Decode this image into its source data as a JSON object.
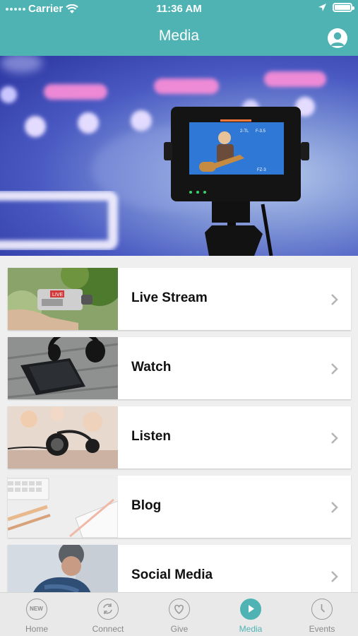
{
  "status_bar": {
    "carrier": "Carrier",
    "time": "11:36 AM"
  },
  "header": {
    "title": "Media"
  },
  "menu": [
    {
      "label": "Live Stream",
      "image": "camcorder-photo"
    },
    {
      "label": "Watch",
      "image": "headphones-phone-photo"
    },
    {
      "label": "Listen",
      "image": "headphones-photo"
    },
    {
      "label": "Blog",
      "image": "keyboard-notebook-photo"
    },
    {
      "label": "Social Media",
      "image": "person-photo"
    }
  ],
  "tabs": [
    {
      "label": "Home",
      "icon": "new-badge-icon",
      "active": false
    },
    {
      "label": "Connect",
      "icon": "sync-arrows-icon",
      "active": false
    },
    {
      "label": "Give",
      "icon": "heart-icon",
      "active": false
    },
    {
      "label": "Media",
      "icon": "play-icon",
      "active": true
    },
    {
      "label": "Events",
      "icon": "clock-icon",
      "active": false
    }
  ],
  "badge": {
    "home_icon_text": "NEW"
  },
  "colors": {
    "accent": "#4fb3b3",
    "tab_inactive": "#8a8a8a",
    "background": "#efefef"
  }
}
